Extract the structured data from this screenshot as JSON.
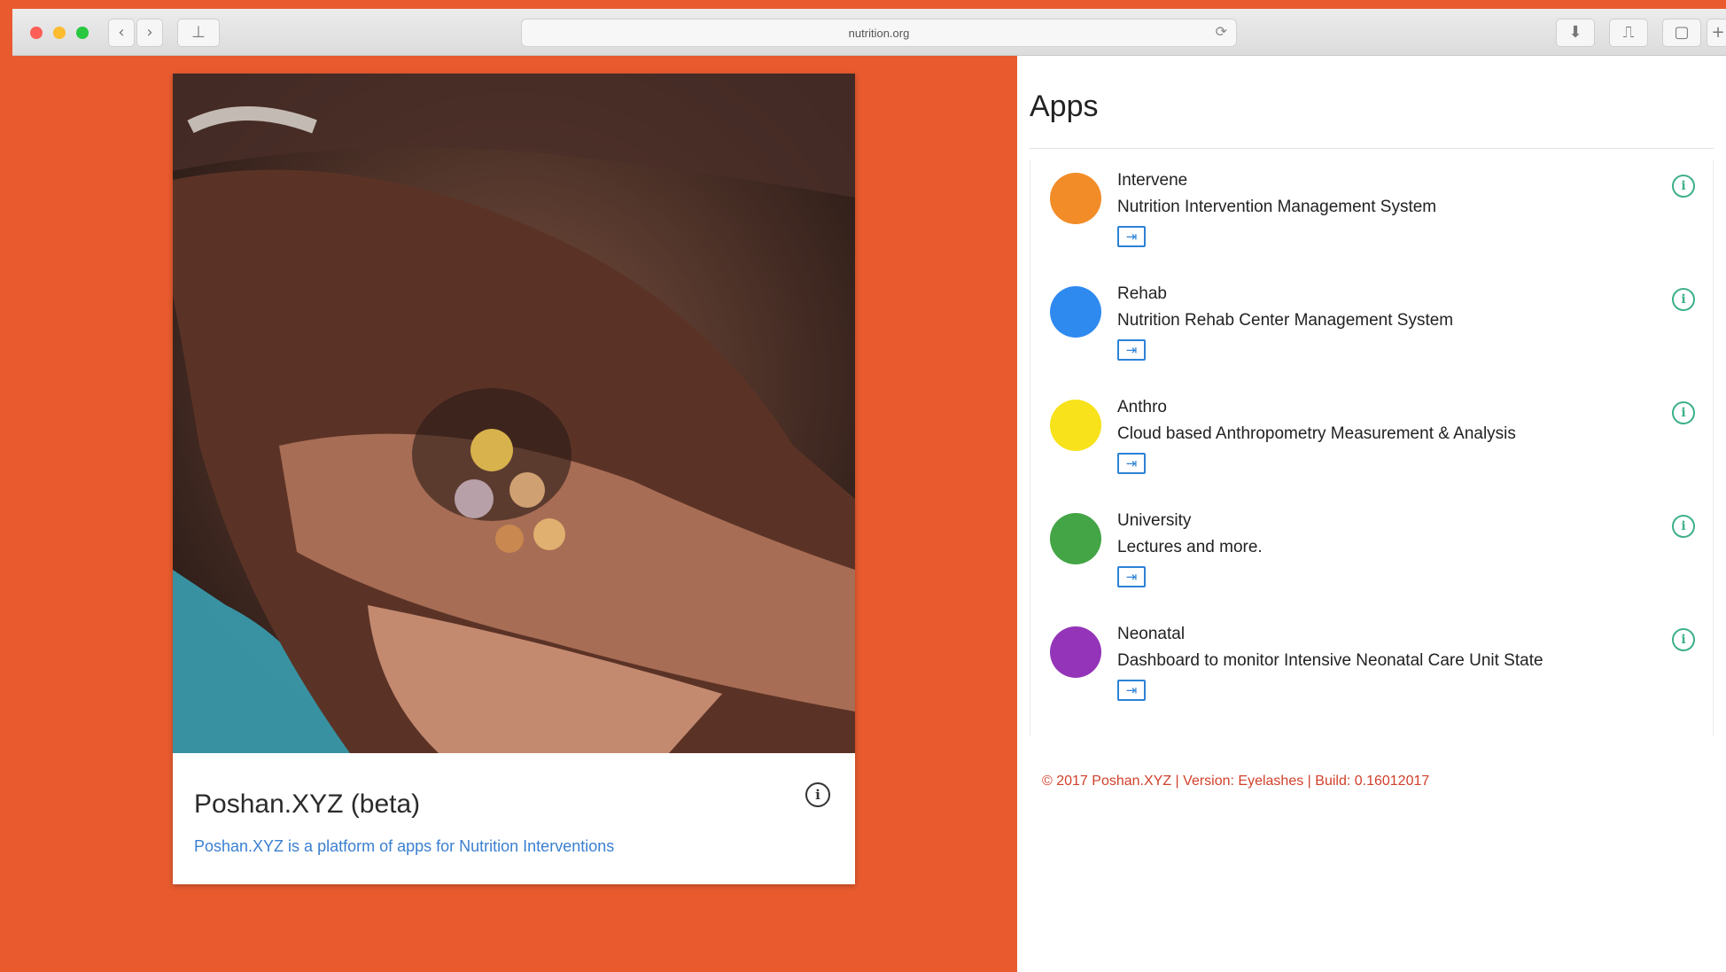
{
  "browser": {
    "url": "nutrition.org",
    "back_icon": "chevron-left-icon",
    "forward_icon": "chevron-right-icon",
    "sidebar_icon": "sidebar-icon",
    "reload_icon": "reload-icon",
    "download_icon": "download-icon",
    "share_icon": "share-icon",
    "tabs_icon": "tabs-icon",
    "new_tab_icon": "plus-icon"
  },
  "hero": {
    "title": "Poshan.XYZ (beta)",
    "description": "Poshan.XYZ is a platform of apps for Nutrition Interventions"
  },
  "apps": {
    "title": "Apps",
    "items": [
      {
        "name": "Intervene",
        "description": "Nutrition Intervention Management System",
        "color": "#f28c28"
      },
      {
        "name": "Rehab",
        "description": "Nutrition Rehab Center Management System",
        "color": "#2f8af0"
      },
      {
        "name": "Anthro",
        "description": "Cloud based Anthropometry Measurement & Analysis",
        "color": "#f7e21b"
      },
      {
        "name": "University",
        "description": "Lectures and more.",
        "color": "#43a545"
      },
      {
        "name": "Neonatal",
        "description": "Dashboard to monitor Intensive Neonatal Care Unit State",
        "color": "#9434b8"
      }
    ]
  },
  "footer": {
    "text": "© 2017 Poshan.XYZ | Version: Eyelashes | Build: 0.16012017"
  },
  "theme": {
    "background": "#e95b2f",
    "link": "#3a7fd0",
    "info_accent": "#3cb087",
    "footer_text": "#d0402a"
  }
}
